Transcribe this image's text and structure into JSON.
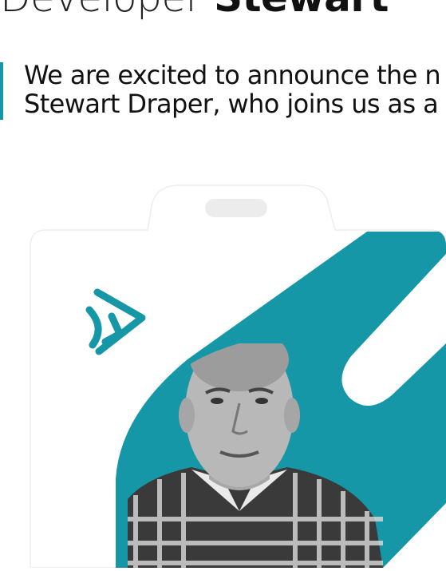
{
  "headline": {
    "line_light": "Developer",
    "line_bold": "Stewart"
  },
  "intro": {
    "line1": "We are excited to announce the n",
    "line2": "Stewart Draper, who joins us as a"
  },
  "badge": {
    "logo_icon": "triangle-play-logo-icon",
    "photo_icon": "person-portrait",
    "accent_color": "#1597a7"
  }
}
